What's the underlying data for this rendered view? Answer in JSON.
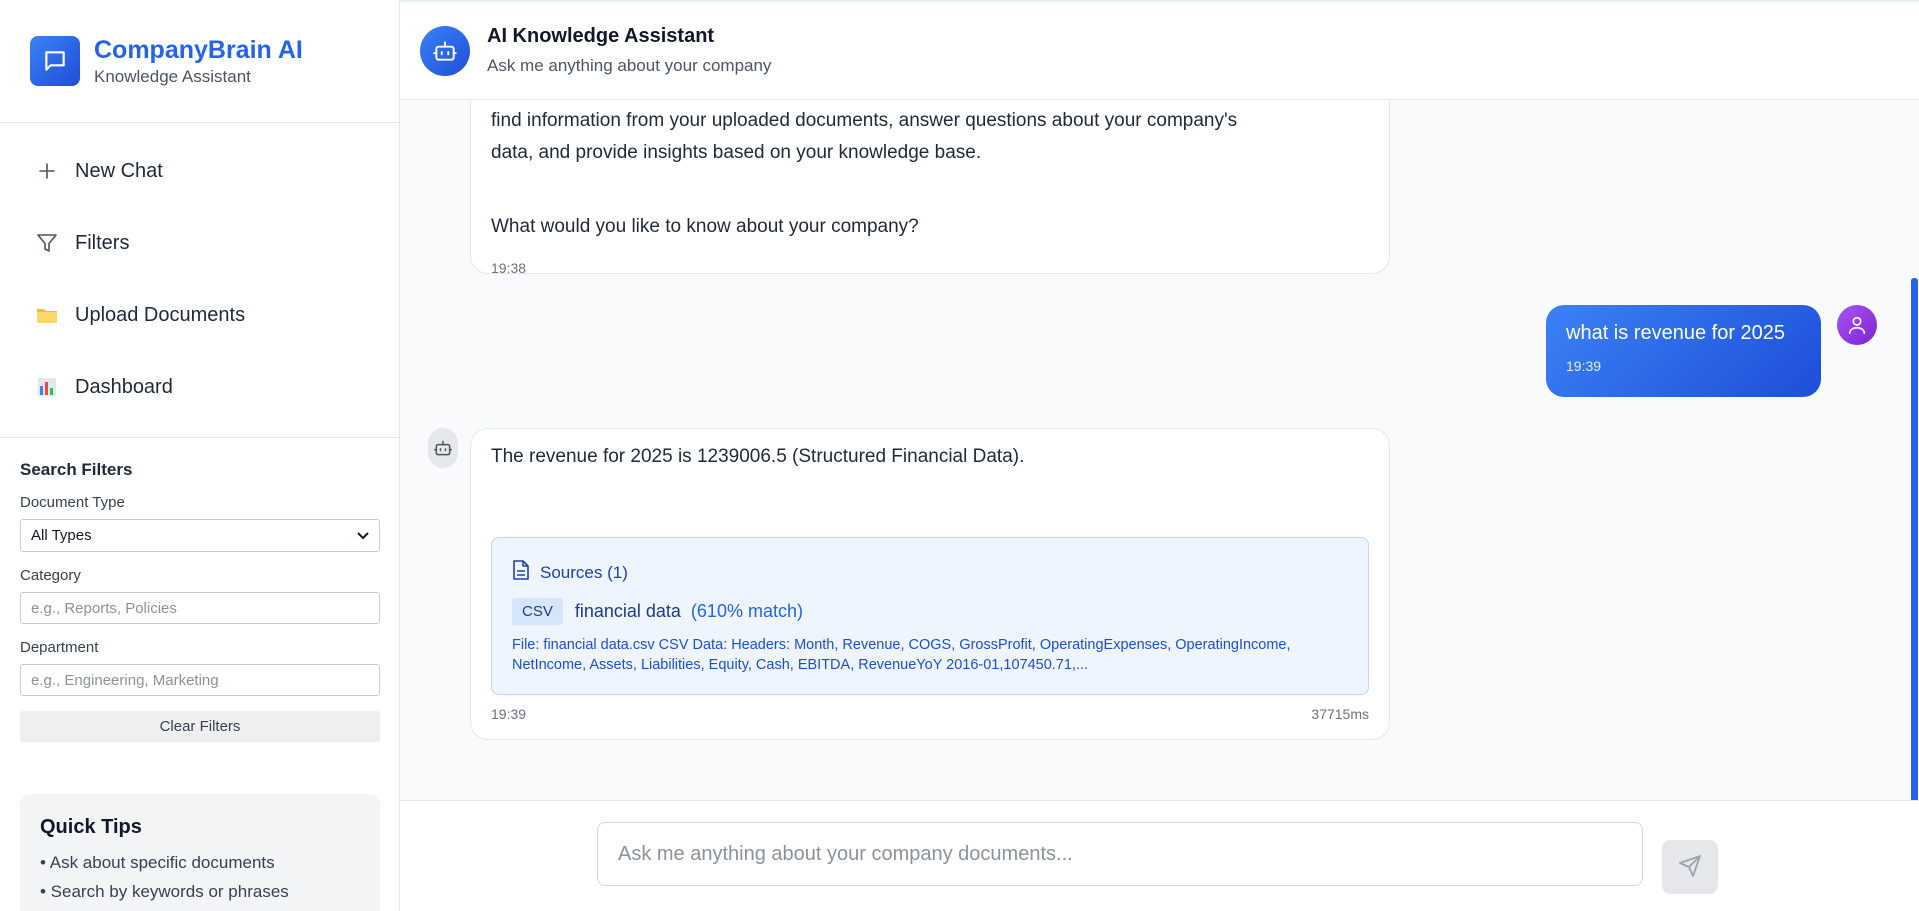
{
  "brand": {
    "title": "CompanyBrain AI",
    "subtitle": "Knowledge Assistant",
    "icon": "chat-bubble-icon"
  },
  "nav": [
    {
      "label": "New Chat",
      "icon": "plus-icon"
    },
    {
      "label": "Filters",
      "icon": "filter-icon"
    },
    {
      "label": "Upload Documents",
      "icon": "folder-icon"
    },
    {
      "label": "Dashboard",
      "icon": "bar-chart-icon"
    }
  ],
  "filters": {
    "title": "Search Filters",
    "document_type_label": "Document Type",
    "document_type_value": "All Types",
    "category_label": "Category",
    "category_placeholder": "e.g., Reports, Policies",
    "department_label": "Department",
    "department_placeholder": "e.g., Engineering, Marketing",
    "clear_label": "Clear Filters"
  },
  "tips": {
    "title": "Quick Tips",
    "items": [
      "• Ask about specific documents",
      "• Search by keywords or phrases"
    ]
  },
  "header": {
    "title": "AI Knowledge Assistant",
    "subtitle": "Ask me anything about your company"
  },
  "messages": {
    "welcome": {
      "line1": "find information from your uploaded documents, answer questions about your company's",
      "line2": "data, and provide insights based on your knowledge base.",
      "line3": "What would you like to know about your company?",
      "time": "19:38"
    },
    "user": {
      "text": "what is revenue for 2025",
      "time": "19:39"
    },
    "answer": {
      "text": "The revenue for 2025 is 1239006.5 (Structured Financial Data).",
      "sources_title": "Sources (1)",
      "source": {
        "badge": "CSV",
        "name": "financial data",
        "match": "(610% match)",
        "preview": "File: financial data.csv CSV Data: Headers: Month, Revenue, COGS, GrossProfit, OperatingExpenses, OperatingIncome, NetIncome, Assets, Liabilities, Equity, Cash, EBITDA, RevenueYoY 2016-01,107450.71,..."
      },
      "time": "19:39",
      "latency": "37715ms"
    }
  },
  "composer": {
    "placeholder": "Ask me anything about your company documents..."
  },
  "colors": {
    "accent": "#2563eb",
    "user_avatar": "#9333ea",
    "sources_bg": "#eef5ff"
  }
}
